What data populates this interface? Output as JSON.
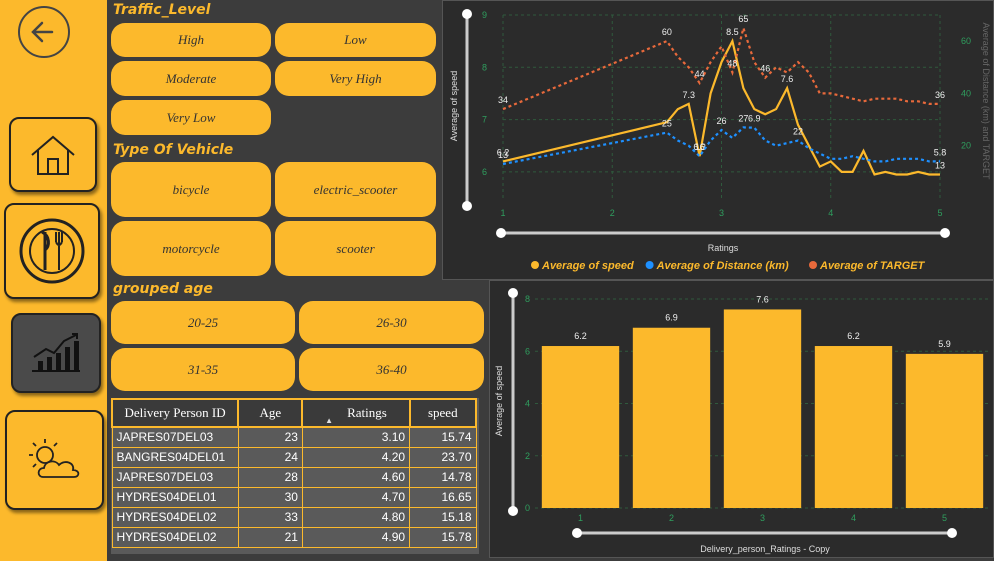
{
  "slicers": {
    "traffic": {
      "title": "Traffic_Level",
      "options": [
        "High",
        "Low",
        "Moderate",
        "Very High",
        "Very Low"
      ]
    },
    "vehicle": {
      "title": "Type Of Vehicle",
      "options": [
        "bicycle",
        "electric_scooter",
        "motorcycle",
        "scooter"
      ]
    },
    "age": {
      "title": "grouped age",
      "options": [
        "20-25",
        "26-30",
        "31-35",
        "36-40"
      ]
    }
  },
  "table": {
    "columns": [
      "Delivery Person ID",
      "Age",
      "Ratings",
      "speed"
    ],
    "rows": [
      [
        "JAPRES07DEL03",
        "23",
        "3.10",
        "15.74"
      ],
      [
        "BANGRES04DEL01",
        "24",
        "4.20",
        "23.70"
      ],
      [
        "JAPRES07DEL03",
        "28",
        "4.60",
        "14.78"
      ],
      [
        "HYDRES04DEL01",
        "30",
        "4.70",
        "16.65"
      ],
      [
        "HYDRES04DEL02",
        "33",
        "4.80",
        "15.18"
      ],
      [
        "HYDRES04DEL02",
        "21",
        "4.90",
        "15.78"
      ]
    ]
  },
  "chart_data": [
    {
      "type": "line",
      "xlabel": "Ratings",
      "ylabel": "Average of speed",
      "y2label": "Average of Distance (km) and TARGET",
      "xlim": [
        1,
        5
      ],
      "ylim": [
        5.5,
        9
      ],
      "y2lim": [
        0,
        70
      ],
      "xticks": [
        "1",
        "2",
        "3",
        "4",
        "5"
      ],
      "yticks": [
        "6",
        "7",
        "8",
        "9"
      ],
      "y2ticks": [
        "20",
        "40",
        "60"
      ],
      "legend": "bottom",
      "series": [
        {
          "name": "Average of speed",
          "color": "#fcb92c",
          "axis": "left",
          "dash": false,
          "points": [
            [
              1.0,
              6.2
            ],
            [
              2.5,
              6.95
            ],
            [
              2.6,
              7.2
            ],
            [
              2.7,
              7.3
            ],
            [
              2.8,
              6.3
            ],
            [
              2.9,
              7.5
            ],
            [
              3.0,
              8.1
            ],
            [
              3.1,
              8.5
            ],
            [
              3.2,
              7.6
            ],
            [
              3.3,
              7.2
            ],
            [
              3.4,
              7.1
            ],
            [
              3.5,
              7.2
            ],
            [
              3.6,
              7.6
            ],
            [
              3.7,
              6.9
            ],
            [
              3.8,
              6.5
            ],
            [
              3.9,
              6.1
            ],
            [
              4.0,
              6.2
            ],
            [
              4.1,
              6.0
            ],
            [
              4.2,
              6.0
            ],
            [
              4.3,
              6.4
            ],
            [
              4.4,
              5.95
            ],
            [
              4.5,
              6.0
            ],
            [
              4.6,
              5.95
            ],
            [
              4.7,
              5.95
            ],
            [
              4.8,
              6.0
            ],
            [
              4.9,
              5.95
            ],
            [
              5.0,
              5.95
            ]
          ],
          "labels": [
            [
              0,
              "6.2"
            ],
            [
              3,
              "7.3"
            ],
            [
              4,
              "6.3"
            ],
            [
              7,
              "8.5"
            ],
            [
              12,
              "7.6"
            ],
            [
              26,
              "13"
            ]
          ]
        },
        {
          "name": "Average of Distance (km)",
          "color": "#1e90ff",
          "axis": "right",
          "dash": true,
          "points": [
            [
              1.0,
              13
            ],
            [
              2.5,
              25
            ],
            [
              2.6,
              22
            ],
            [
              2.7,
              20
            ],
            [
              2.8,
              16
            ],
            [
              2.9,
              22
            ],
            [
              3.0,
              26
            ],
            [
              3.1,
              23
            ],
            [
              3.2,
              27
            ],
            [
              3.3,
              26.9
            ],
            [
              3.4,
              22
            ],
            [
              3.5,
              20
            ],
            [
              3.6,
              21
            ],
            [
              3.7,
              22
            ],
            [
              3.8,
              19
            ],
            [
              3.9,
              17
            ],
            [
              4.0,
              15
            ],
            [
              4.1,
              15
            ],
            [
              4.2,
              16
            ],
            [
              4.3,
              15
            ],
            [
              4.4,
              14
            ],
            [
              4.5,
              14
            ],
            [
              4.6,
              15
            ],
            [
              4.7,
              15
            ],
            [
              4.8,
              15
            ],
            [
              4.9,
              14
            ],
            [
              5.0,
              14
            ]
          ],
          "labels": [
            [
              0,
              "13"
            ],
            [
              1,
              "25"
            ],
            [
              4,
              "16"
            ],
            [
              6,
              "26"
            ],
            [
              8,
              "27"
            ],
            [
              9,
              "6.9"
            ],
            [
              13,
              "22"
            ],
            [
              26,
              "5.8"
            ]
          ]
        },
        {
          "name": "Average of TARGET",
          "color": "#e8693b",
          "axis": "right",
          "dash": true,
          "points": [
            [
              1.0,
              34
            ],
            [
              2.5,
              60
            ],
            [
              2.6,
              54
            ],
            [
              2.7,
              50
            ],
            [
              2.8,
              44
            ],
            [
              2.9,
              52
            ],
            [
              3.0,
              58
            ],
            [
              3.1,
              48
            ],
            [
              3.2,
              65
            ],
            [
              3.3,
              52
            ],
            [
              3.4,
              46
            ],
            [
              3.5,
              50
            ],
            [
              3.6,
              48
            ],
            [
              3.7,
              52
            ],
            [
              3.8,
              48
            ],
            [
              3.9,
              40
            ],
            [
              4.0,
              40
            ],
            [
              4.1,
              39
            ],
            [
              4.2,
              38
            ],
            [
              4.3,
              37
            ],
            [
              4.4,
              38
            ],
            [
              4.5,
              38
            ],
            [
              4.6,
              38
            ],
            [
              4.7,
              37
            ],
            [
              4.8,
              37
            ],
            [
              4.9,
              36
            ],
            [
              5.0,
              36
            ]
          ],
          "labels": [
            [
              0,
              "34"
            ],
            [
              1,
              "60"
            ],
            [
              4,
              "44"
            ],
            [
              7,
              "48"
            ],
            [
              8,
              "65"
            ],
            [
              10,
              "46"
            ],
            [
              26,
              "36"
            ]
          ]
        }
      ]
    },
    {
      "type": "bar",
      "xlabel": "Delivery_person_Ratings - Copy",
      "ylabel": "Average of speed",
      "categories": [
        "1",
        "2",
        "3",
        "4",
        "5"
      ],
      "values": [
        6.2,
        6.9,
        7.6,
        6.2,
        5.9
      ],
      "value_labels": [
        "6.2",
        "6.9",
        "7.6",
        "6.2",
        "5.9"
      ],
      "ylim": [
        0,
        8
      ],
      "yticks": [
        "0",
        "2",
        "4",
        "6",
        "8"
      ],
      "color": "#fcb92c"
    }
  ],
  "colors": {
    "accent": "#fcb92c",
    "background": "#3c3c3c",
    "chart_bg": "#2b2b2b"
  },
  "icons": {
    "back": "back-arrow-icon",
    "home": "home-icon",
    "food": "plate-fork-knife-icon",
    "dashboard": "line-chart-icon",
    "weather": "sun-cloud-icon"
  }
}
